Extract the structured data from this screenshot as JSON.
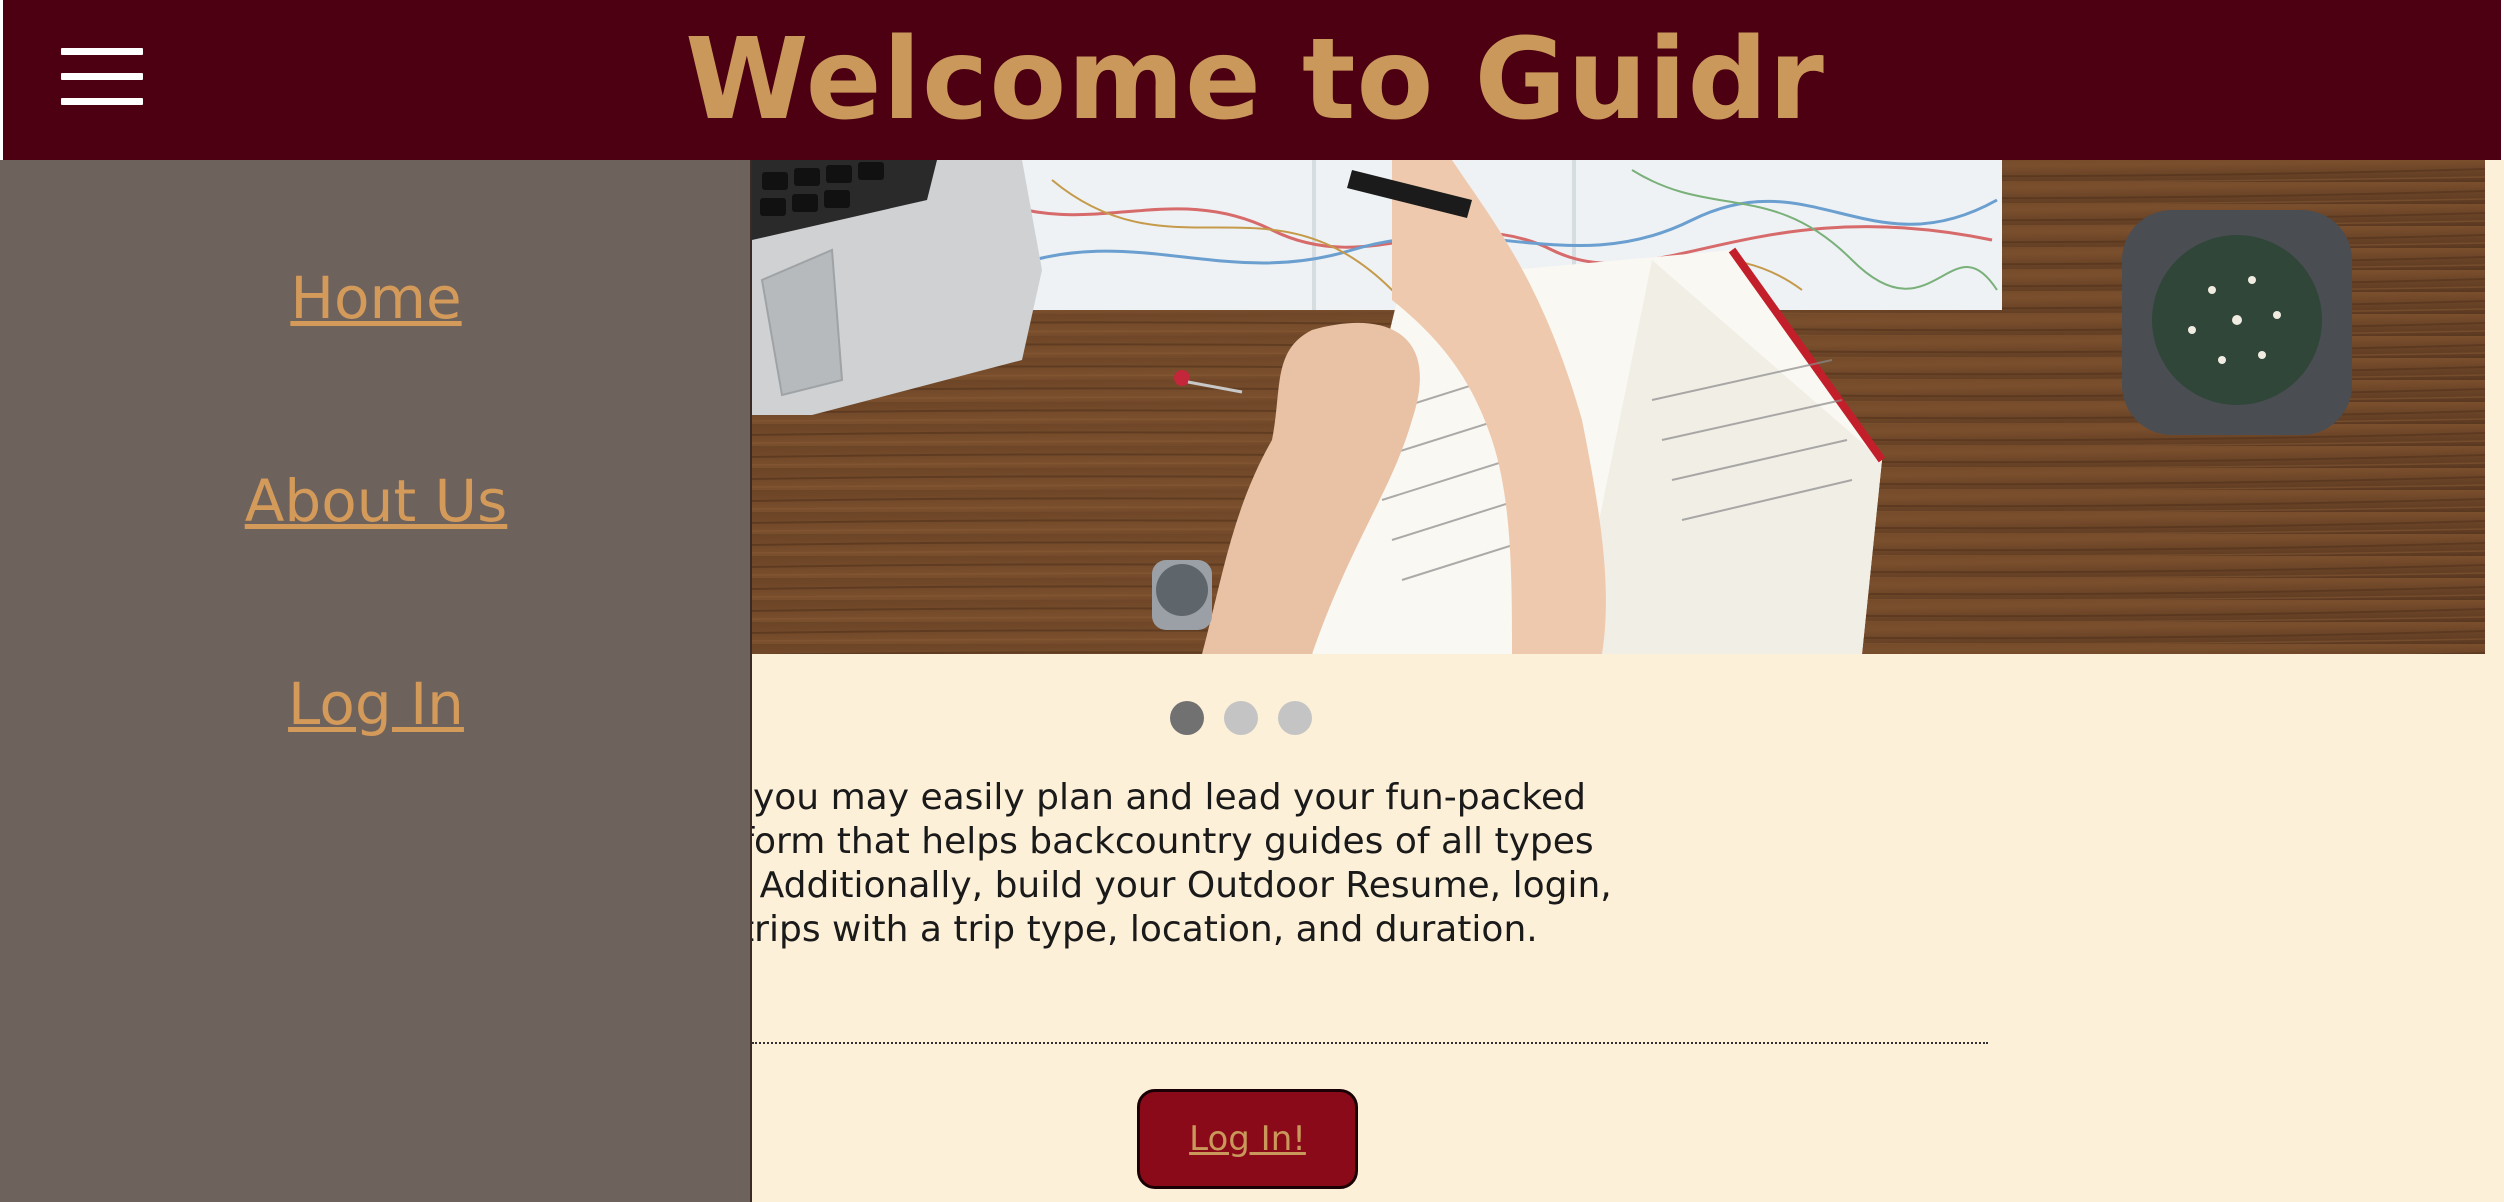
{
  "header": {
    "title": "Welcome to Guidr",
    "menu_icon": "hamburger-menu-icon"
  },
  "drawer": {
    "items": [
      {
        "label": "Home"
      },
      {
        "label": "About Us"
      },
      {
        "label": "Log In"
      }
    ]
  },
  "hero": {
    "image": "travel-planning-desk-photo"
  },
  "carousel": {
    "slide_count": 3,
    "active_index": 0
  },
  "intro": {
    "lines": [
      " we made it so that you may easily plan and lead your fun-packed",
      "idr is the go-to platform that helps backcountry guides of all types",
      "te/professional trips. Additionally, build your Outdoor Resume, login,",
      "nd update your trips with a trip type, location, and duration."
    ]
  },
  "cta": {
    "login_label": "Log In!"
  },
  "colors": {
    "header_bg": "#4d0011",
    "title": "#c9985a",
    "drawer_bg": "#6e625d",
    "link": "#d39a5a",
    "page_bg": "#fdf0d8",
    "button_bg": "#8b0a1a"
  }
}
